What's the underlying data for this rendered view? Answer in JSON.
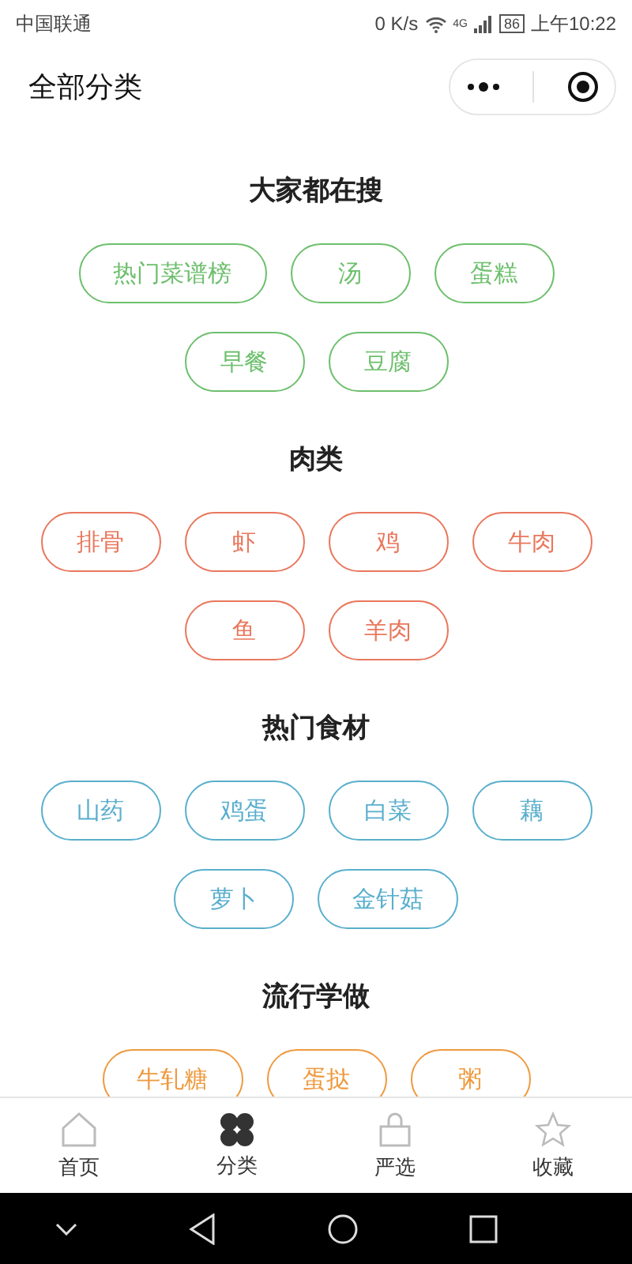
{
  "status_bar": {
    "carrier": "中国联通",
    "speed": "0 K/s",
    "network": "4G",
    "battery": "86",
    "time": "上午10:22"
  },
  "header": {
    "title": "全部分类"
  },
  "sections": [
    {
      "title": "大家都在搜",
      "color": "#6dbf6d",
      "tags": [
        "热门菜谱榜",
        "汤",
        "蛋糕",
        "早餐",
        "豆腐"
      ]
    },
    {
      "title": "肉类",
      "color": "#e9775d",
      "tags": [
        "排骨",
        "虾",
        "鸡",
        "牛肉",
        "鱼",
        "羊肉"
      ]
    },
    {
      "title": "热门食材",
      "color": "#5aafcd",
      "tags": [
        "山药",
        "鸡蛋",
        "白菜",
        "藕",
        "萝卜",
        "金针菇"
      ]
    },
    {
      "title": "流行学做",
      "color": "#ee9a3f",
      "tags": [
        "牛轧糖",
        "蛋挞",
        "粥"
      ]
    }
  ],
  "tab_bar": [
    {
      "label": "首页",
      "kind": "home",
      "selected": false
    },
    {
      "label": "分类",
      "kind": "category",
      "selected": true
    },
    {
      "label": "严选",
      "kind": "bag",
      "selected": false
    },
    {
      "label": "收藏",
      "kind": "star",
      "selected": false
    }
  ]
}
